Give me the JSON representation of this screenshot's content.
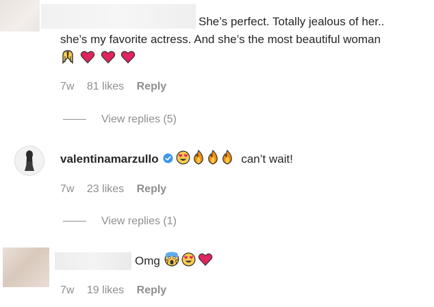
{
  "comments": [
    {
      "text_line1": "She’s perfect. Totally jealous of her..",
      "text_line2": "she’s my favorite actress. And she’s the most beautiful woman",
      "emojis": [
        "folded-hands-emoji",
        "red-heart-emoji",
        "red-heart-emoji",
        "red-heart-emoji"
      ],
      "time": "7w",
      "likes": "81 likes",
      "reply": "Reply",
      "view_replies": "View replies (5)"
    },
    {
      "username": "valentinamarzullo",
      "verified": true,
      "emojis": [
        "heart-eyes-emoji",
        "fire-emoji",
        "fire-emoji",
        "fire-emoji"
      ],
      "text": "can’t wait!",
      "time": "7w",
      "likes": "23 likes",
      "reply": "Reply",
      "view_replies": "View replies (1)"
    },
    {
      "text": "Omg",
      "emojis": [
        "screaming-face-emoji",
        "heart-eyes-emoji",
        "red-heart-emoji"
      ],
      "time": "7w",
      "likes": "19 likes",
      "reply": "Reply"
    }
  ],
  "colors": {
    "text": "#262626",
    "secondary": "#8e8e8e",
    "verified": "#3897f0",
    "heart": "#e0245e",
    "emoji_yellow": "#ffcc4d"
  }
}
